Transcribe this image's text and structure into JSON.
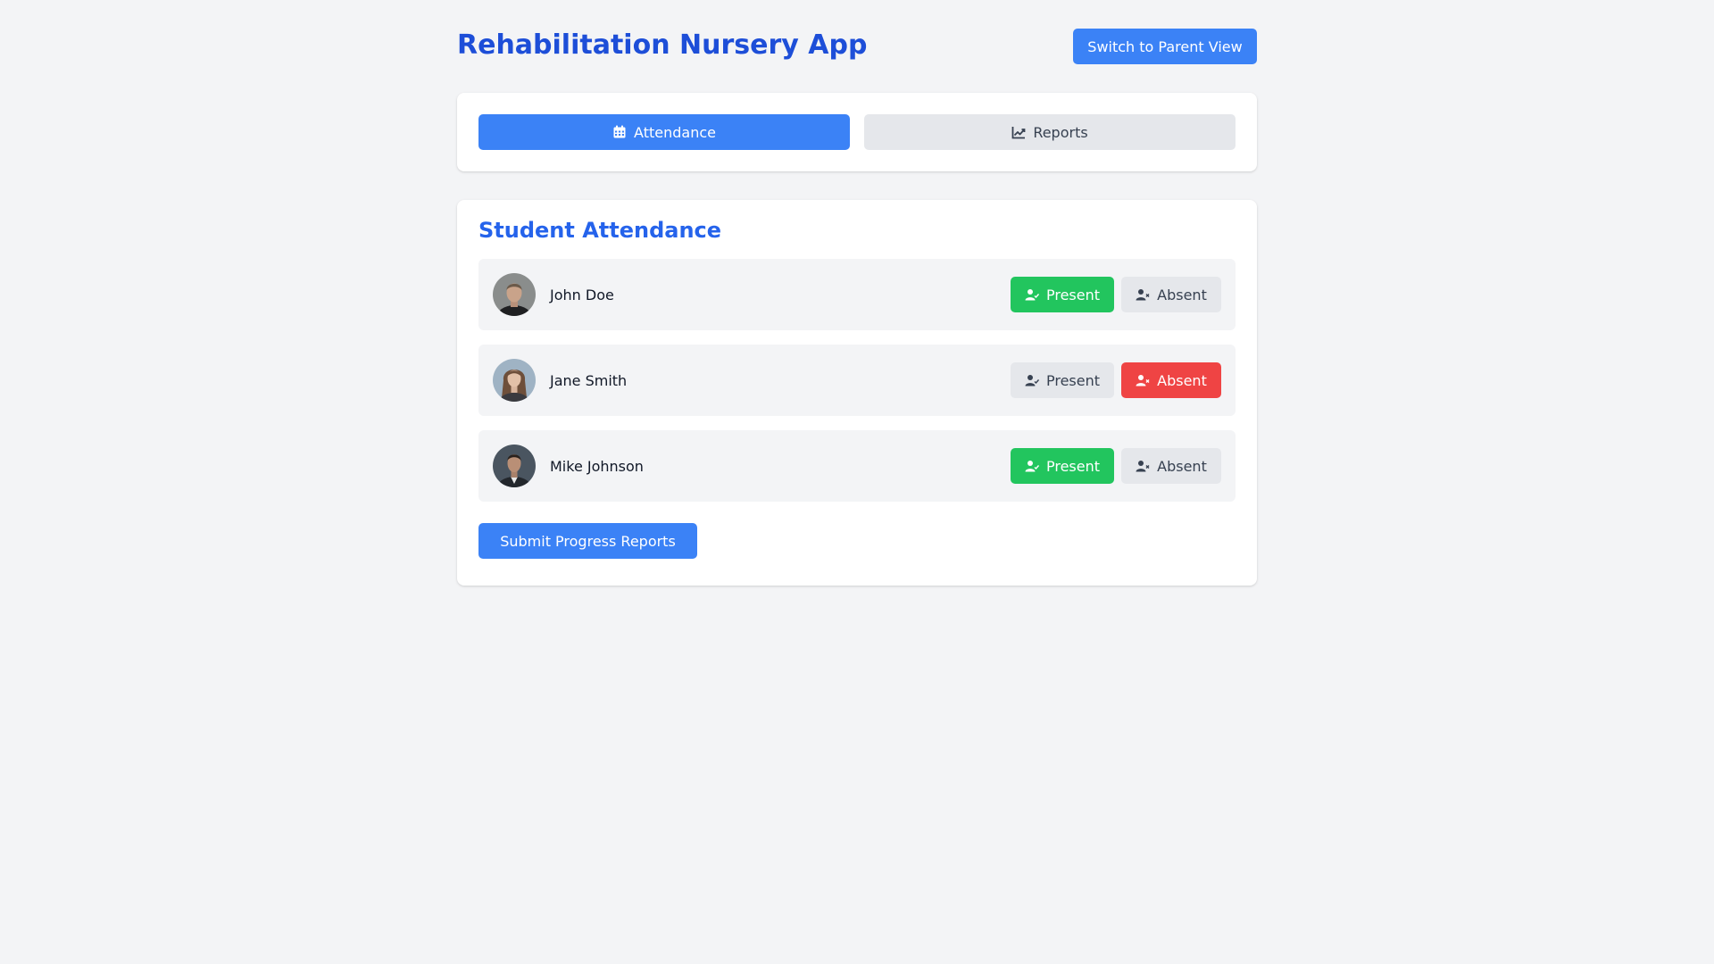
{
  "app": {
    "title": "Rehabilitation Nursery App",
    "switch_view_label": "Switch to Parent View"
  },
  "tabs": [
    {
      "label": "Attendance",
      "icon": "calendar-icon",
      "active": true
    },
    {
      "label": "Reports",
      "icon": "chart-line-icon",
      "active": false
    }
  ],
  "attendance": {
    "title": "Student Attendance",
    "present_label": "Present",
    "absent_label": "Absent",
    "students": [
      {
        "name": "John Doe",
        "status": "present"
      },
      {
        "name": "Jane Smith",
        "status": "absent"
      },
      {
        "name": "Mike Johnson",
        "status": "present"
      }
    ],
    "submit_label": "Submit Progress Reports"
  },
  "colors": {
    "primary": "#3b82f6",
    "title": "#1d4ed8",
    "present": "#22c55e",
    "absent": "#ef4444",
    "inactive": "#e5e7eb"
  }
}
